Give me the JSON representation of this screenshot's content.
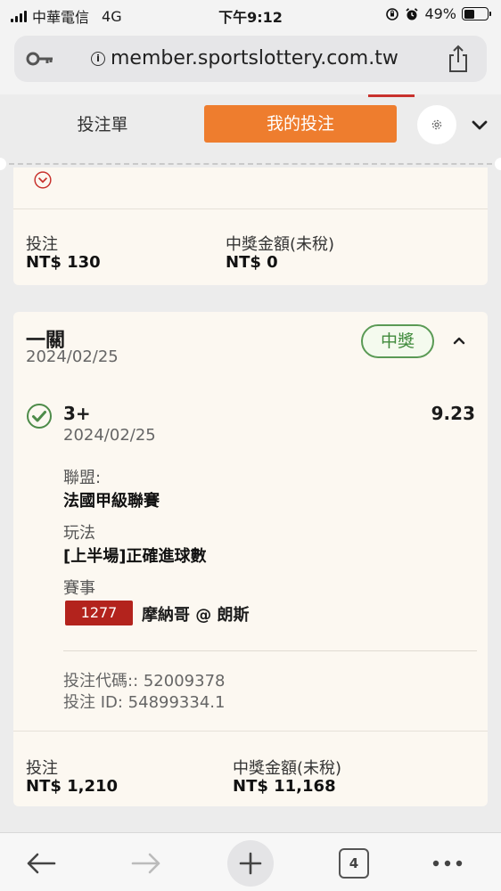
{
  "status_bar": {
    "carrier": "中華電信",
    "network": "4G",
    "time": "下午9:12",
    "battery": "49%",
    "battery_level": 0.49
  },
  "browser": {
    "url": "member.sportslottery.com.tw",
    "tab_count": "4"
  },
  "header": {
    "tab_betslip": "投注單",
    "tab_mybets": "我的投注"
  },
  "card_previous": {
    "stake_label": "投注",
    "stake_value": "NT$ 130",
    "payout_label": "中獎金額(未稅)",
    "payout_value": "NT$ 0"
  },
  "card_current": {
    "bet_type": "一關",
    "bet_date": "2024/02/25",
    "status_badge": "中獎",
    "selection": {
      "name": "3+",
      "odds": "9.23",
      "date": "2024/02/25",
      "league_label": "聯盟:",
      "league_value": "法國甲級聯賽",
      "market_label": "玩法",
      "market_value": "[上半場]正確進球數",
      "event_label": "賽事",
      "event_code": "1277",
      "event_name": "摩納哥 @ 朗斯"
    },
    "bet_code": "投注代碼:: 52009378",
    "bet_id": "投注 ID: 54899334.1",
    "stake_label": "投注",
    "stake_value": "NT$ 1,210",
    "payout_label": "中獎金額(未稅)",
    "payout_value": "NT$ 11,168"
  },
  "colors": {
    "accent_orange": "#ee7d2e",
    "win_green": "#3f8a3b",
    "event_red": "#b3231d",
    "loss_red": "#c8322d"
  }
}
